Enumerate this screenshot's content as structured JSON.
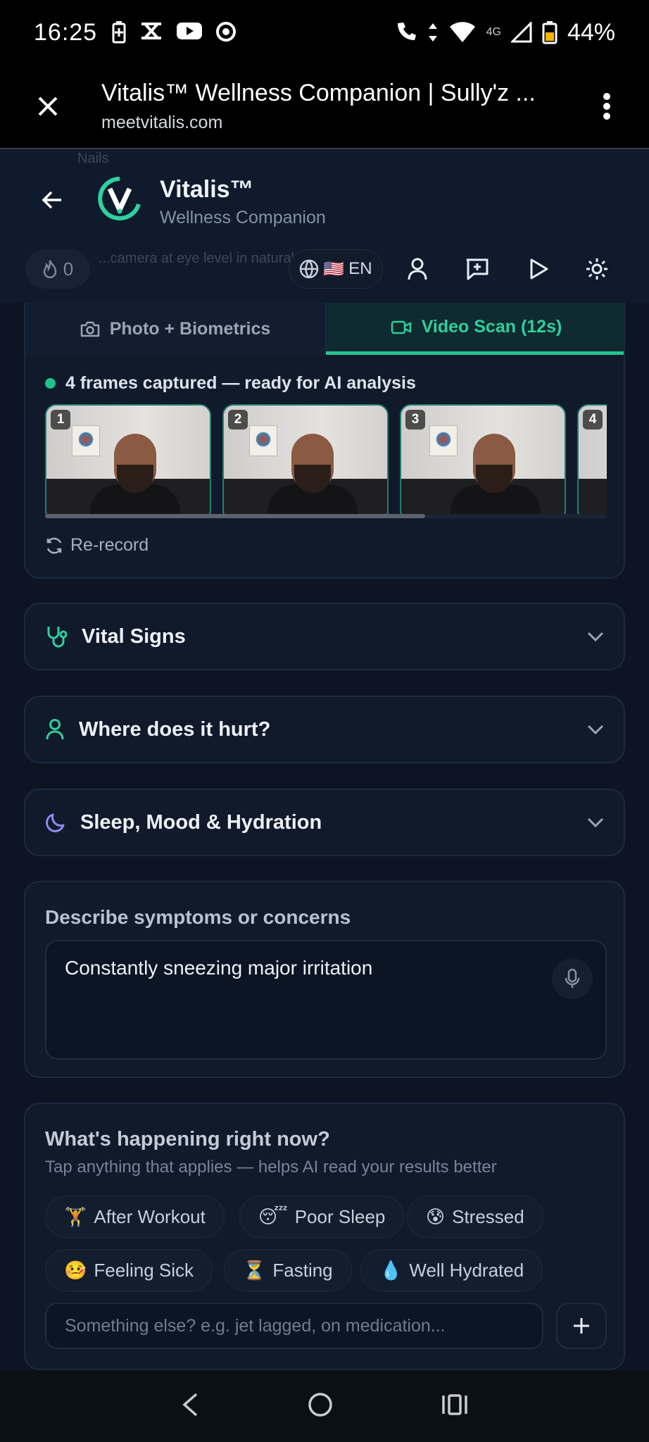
{
  "status_bar": {
    "time": "16:25",
    "network": "4G",
    "battery": "44%"
  },
  "browser": {
    "title": "Vitalis™ Wellness Companion | Sully'z ...",
    "url": "meetvitalis.com"
  },
  "header": {
    "brand_name": "Vitalis™",
    "brand_sub": "Wellness Companion",
    "ghost_text_1": "Nails",
    "ghost_text_2": "...camera at eye level in natural light",
    "streak_count": "0",
    "language": "EN",
    "language_flag": "🇺🇸"
  },
  "scan": {
    "tab_photo": "Photo + Biometrics",
    "tab_video": "Video Scan (12s)",
    "status": "4 frames captured — ready for AI analysis",
    "frames": [
      "1",
      "2",
      "3",
      "4"
    ],
    "rerecord": "Re-record"
  },
  "accordions": {
    "vitals": "Vital Signs",
    "pain": "Where does it hurt?",
    "sleep": "Sleep, Mood & Hydration"
  },
  "symptoms": {
    "title": "Describe symptoms or concerns",
    "value": "Constantly sneezing major irritation"
  },
  "context": {
    "title": "What's happening right now?",
    "subtitle": "Tap anything that applies — helps AI read your results better",
    "chips": [
      {
        "emoji": "🏋",
        "label": "After Workout"
      },
      {
        "emoji": "😴",
        "label": "Poor Sleep"
      },
      {
        "emoji": "😰",
        "label": "Stressed"
      },
      {
        "emoji": "🤒",
        "label": "Feeling Sick"
      },
      {
        "emoji": "⏳",
        "label": "Fasting"
      },
      {
        "emoji": "💧",
        "label": "Well Hydrated"
      }
    ],
    "other_placeholder": "Something else? e.g. jet lagged, on medication..."
  },
  "colors": {
    "accent": "#25c48f",
    "background": "#0d1525",
    "card": "#101a2b"
  }
}
